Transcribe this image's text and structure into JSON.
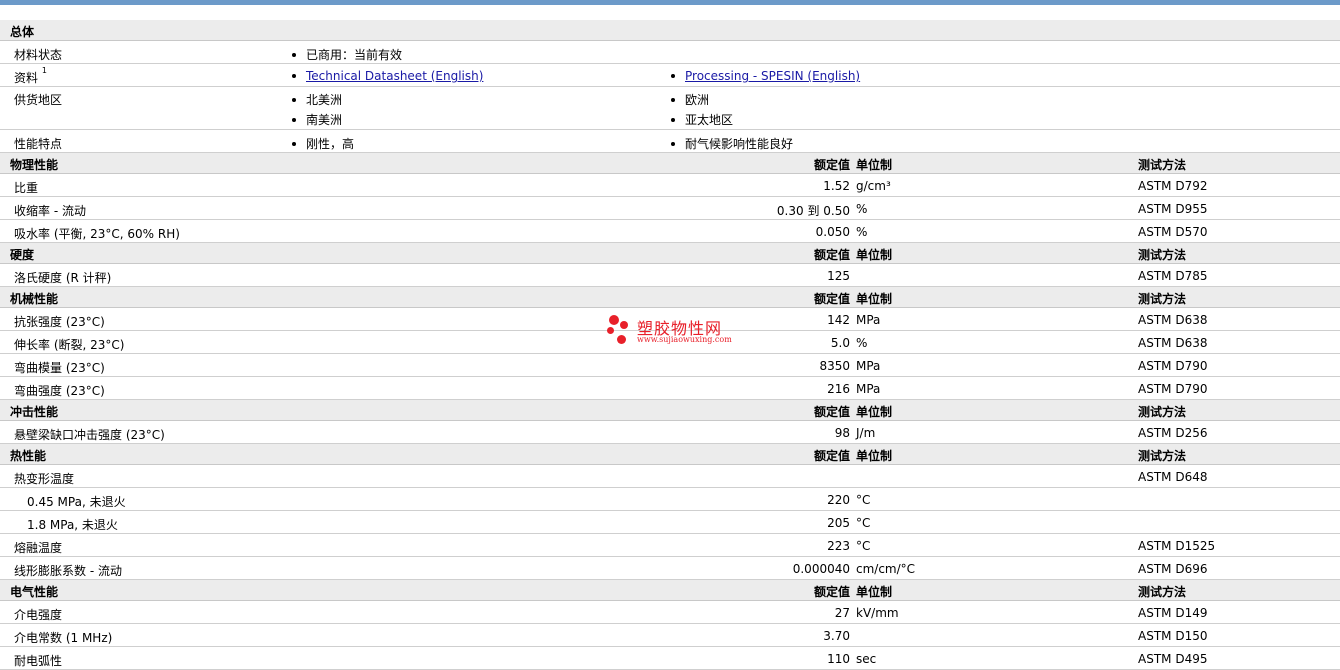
{
  "sections": [
    {
      "title": "总体",
      "type": "general",
      "rows": [
        {
          "label": "材料状态",
          "items": [
            {
              "text": "已商用：当前有效"
            }
          ]
        },
        {
          "label": "资料",
          "sup": "1",
          "items": [
            {
              "text": "Technical Datasheet (English)",
              "link": true
            },
            {
              "text": "Processing - SPESIN (English)",
              "link": true
            }
          ]
        },
        {
          "label": "供货地区",
          "items": [
            {
              "text": "北美洲"
            },
            {
              "text": "欧洲"
            },
            {
              "text": "南美洲"
            },
            {
              "text": "亚太地区"
            }
          ]
        },
        {
          "label": "性能特点",
          "items": [
            {
              "text": "刚性，高"
            },
            {
              "text": "耐气候影响性能良好"
            }
          ]
        }
      ]
    },
    {
      "title": "物理性能",
      "type": "data",
      "rows": [
        {
          "label": "比重",
          "value": "1.52",
          "unit": "g/cm³",
          "test": "ASTM D792"
        },
        {
          "label": "收缩率 - 流动",
          "value": "0.30 到  0.50",
          "unit": "%",
          "test": "ASTM D955"
        },
        {
          "label": "吸水率 (平衡, 23°C, 60% RH)",
          "value": "0.050",
          "unit": "%",
          "test": "ASTM D570"
        }
      ]
    },
    {
      "title": "硬度",
      "type": "data",
      "rows": [
        {
          "label": "洛氏硬度 (R 计秤)",
          "value": "125",
          "unit": "",
          "test": "ASTM D785"
        }
      ]
    },
    {
      "title": "机械性能",
      "type": "data",
      "rows": [
        {
          "label": "抗张强度 (23°C)",
          "value": "142",
          "unit": "MPa",
          "test": "ASTM D638"
        },
        {
          "label": "伸长率 (断裂, 23°C)",
          "value": "5.0",
          "unit": "%",
          "test": "ASTM D638"
        },
        {
          "label": "弯曲模量 (23°C)",
          "value": "8350",
          "unit": "MPa",
          "test": "ASTM D790"
        },
        {
          "label": "弯曲强度 (23°C)",
          "value": "216",
          "unit": "MPa",
          "test": "ASTM D790"
        }
      ]
    },
    {
      "title": "冲击性能",
      "type": "data",
      "rows": [
        {
          "label": "悬壁梁缺口冲击强度 (23°C)",
          "value": "98",
          "unit": "J/m",
          "test": "ASTM D256"
        }
      ]
    },
    {
      "title": "热性能",
      "type": "data",
      "rows": [
        {
          "label": "热变形温度",
          "value": "",
          "unit": "",
          "test": "ASTM D648"
        },
        {
          "label": "0.45 MPa, 未退火",
          "sub": true,
          "value": "220",
          "unit": "°C",
          "test": ""
        },
        {
          "label": "1.8 MPa, 未退火",
          "sub": true,
          "value": "205",
          "unit": "°C",
          "test": ""
        },
        {
          "label": "熔融温度",
          "value": "223",
          "unit": "°C",
          "test": "ASTM D1525"
        },
        {
          "label": "线形膨胀系数 - 流动",
          "value": "0.000040",
          "unit": "cm/cm/°C",
          "test": "ASTM D696"
        }
      ]
    },
    {
      "title": "电气性能",
      "type": "data",
      "rows": [
        {
          "label": "介电强度",
          "value": "27",
          "unit": "kV/mm",
          "test": "ASTM D149"
        },
        {
          "label": "介电常数 (1 MHz)",
          "value": "3.70",
          "unit": "",
          "test": "ASTM D150"
        },
        {
          "label": "耐电弧性",
          "value": "110",
          "unit": "sec",
          "test": "ASTM D495"
        }
      ]
    }
  ],
  "headers": {
    "value": "额定值",
    "unit": "单位制",
    "test": "测试方法"
  },
  "watermark": {
    "name": "塑胶物性网",
    "url": "www.sujiaowuxing.com"
  },
  "colors": {
    "link": "#1a1aa6",
    "section_bg": "#ececec",
    "top_bar": "#6c9ac9",
    "watermark": "#e8202a"
  }
}
